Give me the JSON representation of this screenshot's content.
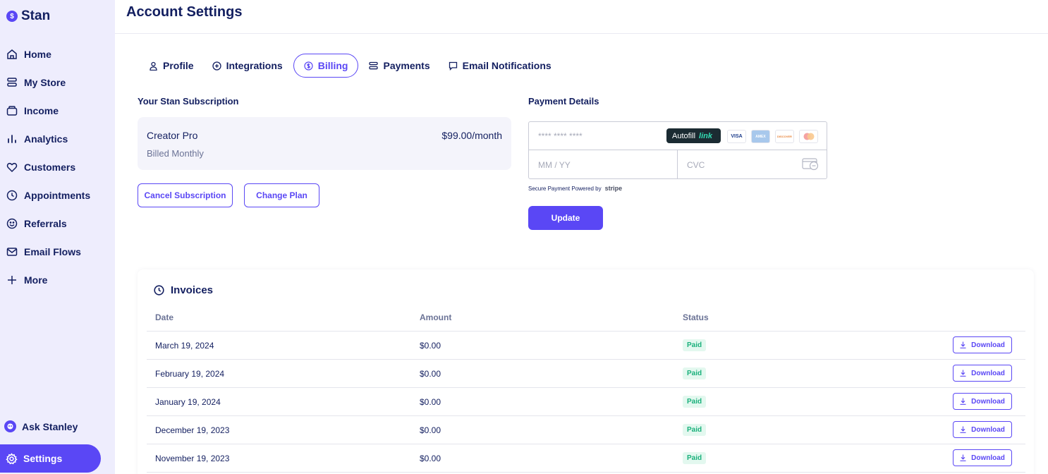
{
  "app": {
    "logo_text": "Stan",
    "logo_glyph": "$"
  },
  "page_title": "Account Settings",
  "sidebar": {
    "items": [
      {
        "label": "Home",
        "icon": "home-icon"
      },
      {
        "label": "My Store",
        "icon": "store-icon"
      },
      {
        "label": "Income",
        "icon": "wallet-icon"
      },
      {
        "label": "Analytics",
        "icon": "bar-chart-icon"
      },
      {
        "label": "Customers",
        "icon": "heart-icon"
      },
      {
        "label": "Appointments",
        "icon": "clock-icon"
      },
      {
        "label": "Referrals",
        "icon": "smile-icon"
      },
      {
        "label": "Email Flows",
        "icon": "mail-icon"
      },
      {
        "label": "More",
        "icon": "plus-icon"
      }
    ],
    "ask_label": "Ask Stanley",
    "settings_label": "Settings"
  },
  "tabs": [
    {
      "label": "Profile",
      "icon": "user-icon",
      "active": false
    },
    {
      "label": "Integrations",
      "icon": "plus-circle-icon",
      "active": false
    },
    {
      "label": "Billing",
      "icon": "dollar-circle-icon",
      "active": true
    },
    {
      "label": "Payments",
      "icon": "stack-icon",
      "active": false
    },
    {
      "label": "Email Notifications",
      "icon": "message-icon",
      "active": false
    }
  ],
  "subscription": {
    "title": "Your Stan Subscription",
    "plan": "Creator Pro",
    "billing": "Billed Monthly",
    "price": "$99.00/month",
    "cancel_label": "Cancel Subscription",
    "change_label": "Change Plan"
  },
  "payment": {
    "title": "Payment Details",
    "card_placeholder": "**** **** ****",
    "autofill_label": "Autofill",
    "autofill_brand": "link",
    "card_logos": [
      "VISA",
      "AMEX",
      "DISCOVER",
      "mastercard"
    ],
    "expiry_placeholder": "MM / YY",
    "cvc_placeholder": "CVC",
    "secure_text": "Secure Payment Powered by",
    "secure_brand": "stripe",
    "update_label": "Update"
  },
  "invoices": {
    "title": "Invoices",
    "columns": {
      "date": "Date",
      "amount": "Amount",
      "status": "Status"
    },
    "download_label": "Download",
    "rows": [
      {
        "date": "March 19, 2024",
        "amount": "$0.00",
        "status": "Paid"
      },
      {
        "date": "February 19, 2024",
        "amount": "$0.00",
        "status": "Paid"
      },
      {
        "date": "January 19, 2024",
        "amount": "$0.00",
        "status": "Paid"
      },
      {
        "date": "December 19, 2023",
        "amount": "$0.00",
        "status": "Paid"
      },
      {
        "date": "November 19, 2023",
        "amount": "$0.00",
        "status": "Paid"
      }
    ]
  },
  "colors": {
    "accent": "#5a47f5",
    "text": "#131f60",
    "sidebar_bg": "#eeedfd",
    "paid_bg": "#e3f8ef",
    "paid_text": "#1ab07b"
  }
}
